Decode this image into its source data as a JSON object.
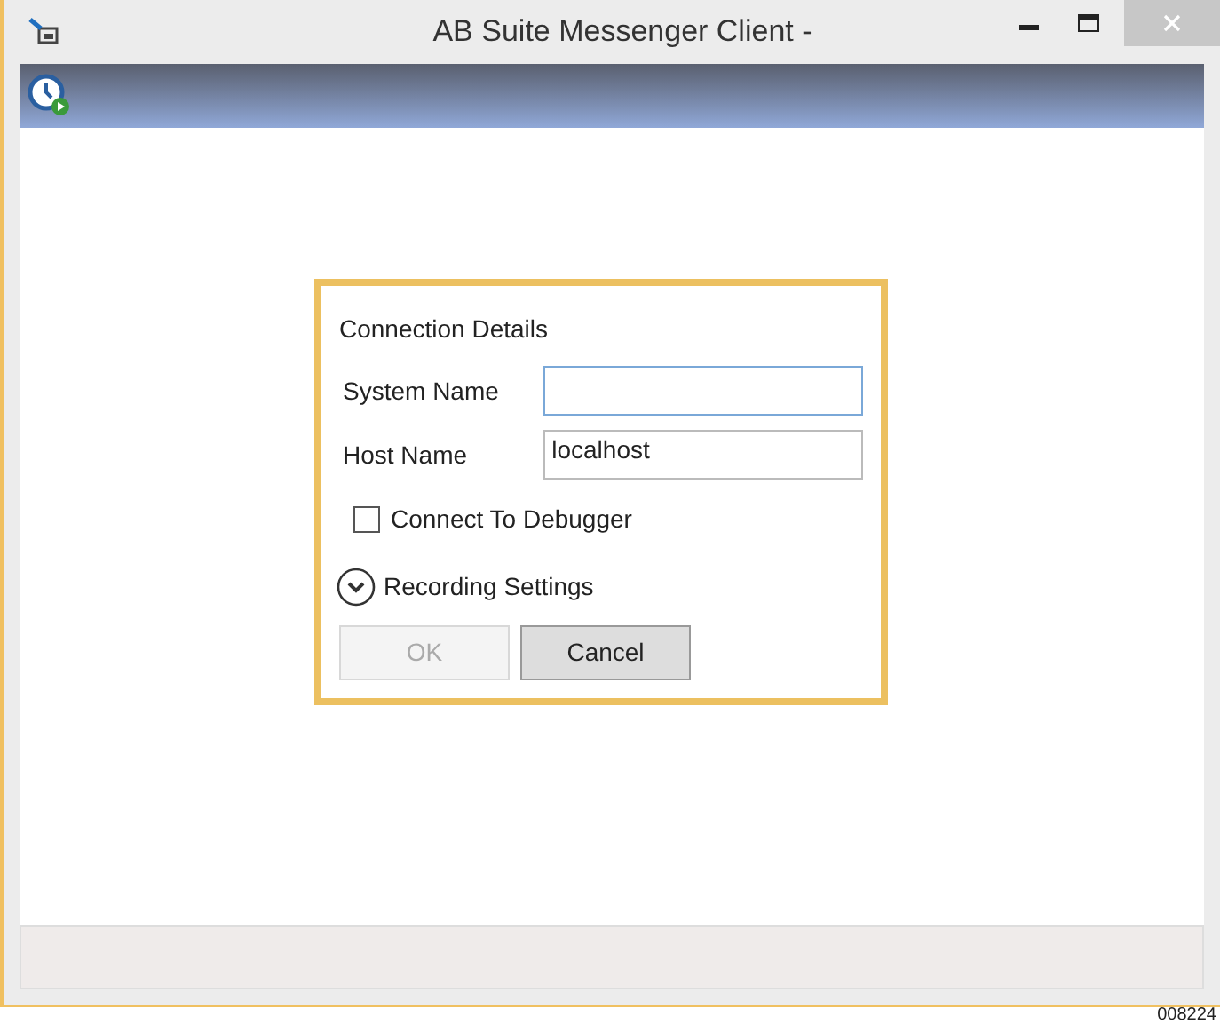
{
  "window": {
    "title": "AB Suite Messenger Client -"
  },
  "dialog": {
    "title": "Connection Details",
    "fields": [
      {
        "label": "System Name",
        "focused": true
      },
      {
        "label": "Host Name",
        "value": "localhost",
        "focused": false
      }
    ],
    "checkbox": {
      "label": "Connect To Debugger",
      "checked": false
    },
    "expander": {
      "label": "Recording Settings",
      "expanded": false
    },
    "buttons": [
      {
        "label": "OK",
        "disabled": true
      },
      {
        "label": "Cancel",
        "disabled": false
      }
    ]
  },
  "figure_number": "008224"
}
